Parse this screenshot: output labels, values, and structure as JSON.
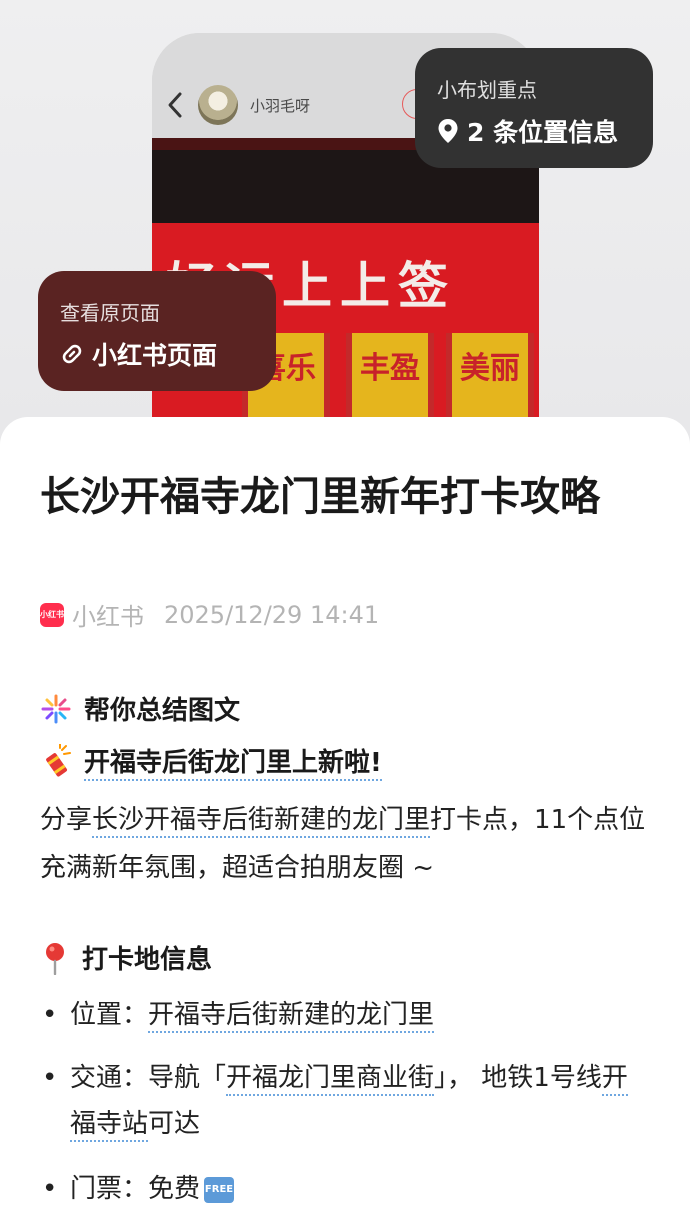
{
  "preview": {
    "author_name": "小羽毛呀",
    "sign_text": "好运上上签",
    "scrolls": [
      "喜乐",
      "丰盈",
      "美丽"
    ],
    "location_overlay": {
      "title": "小布划重点",
      "label": "2 条位置信息",
      "icon": "location-pin-icon"
    },
    "source_overlay": {
      "title": "查看原页面",
      "label": "小红书页面",
      "icon": "link-icon"
    }
  },
  "article": {
    "title": "长沙开福寺龙门里新年打卡攻略",
    "app_badge": "小红书",
    "source": "小红书",
    "datetime": "2025/12/29 14:41",
    "summary_heading": "帮你总结图文",
    "news_heading": "开福寺后街龙门里上新啦!",
    "intro": {
      "part1": "分享",
      "link1": "长沙开福寺后街新建的龙门里",
      "part2": "打卡点，11个点位充满新年氛围，超适合拍朋友圈 ~"
    },
    "info_heading": "打卡地信息",
    "items": [
      {
        "label": "位置：",
        "link": "开福寺后街新建的龙门里",
        "rest": ""
      },
      {
        "label": "交通：导航「",
        "link": "开福龙门里商业街",
        "rest": "」， 地铁1号线",
        "link2": "开福寺站",
        "rest2": "可达"
      },
      {
        "label": "门票：免费",
        "badge": "FREE"
      }
    ]
  },
  "colors": {
    "accent_red": "#ff2e4d",
    "link_underline": "#6fa7e0",
    "location_bg": "#323232",
    "source_bg": "#5a2322"
  }
}
